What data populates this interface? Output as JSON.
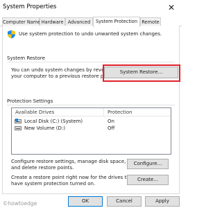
{
  "window": {
    "title": "System Properties",
    "close_glyph": "✕"
  },
  "tabs": [
    {
      "label": "Computer Name"
    },
    {
      "label": "Hardware"
    },
    {
      "label": "Advanced"
    },
    {
      "label": "System Protection",
      "active": true
    },
    {
      "label": "Remote"
    }
  ],
  "intro": {
    "icon": "shield-icon",
    "text": "Use system protection to undo unwanted system changes."
  },
  "system_restore": {
    "group_label": "System Restore",
    "description": [
      "You can undo system changes by reverting",
      "your computer to a previous restore point."
    ],
    "button_label": "System Restore...",
    "highlight_color": "#e0202a"
  },
  "protection_settings": {
    "group_label": "Protection Settings",
    "columns": [
      "Available Drives",
      "Protection"
    ],
    "drives": [
      {
        "name": "Local Disk (C:) (System)",
        "protection": "On",
        "icon": "system-drive-icon"
      },
      {
        "name": "New Volume (D:)",
        "protection": "Off",
        "icon": "drive-icon"
      }
    ]
  },
  "configure": {
    "description": [
      "Configure restore settings, manage disk space,",
      "and delete restore points."
    ],
    "button_label": "Configure..."
  },
  "create": {
    "description": [
      "Create a restore point right now for the drives that",
      "have system protection turned on."
    ],
    "button_label": "Create..."
  },
  "dialog_buttons": {
    "ok": "OK",
    "cancel": "Cancel",
    "apply": "Apply"
  },
  "watermark": "©howtoedge",
  "colors": {
    "accent": "#0078d7",
    "shield_blue": "#1e88e5",
    "shield_yellow": "#f3c623"
  }
}
